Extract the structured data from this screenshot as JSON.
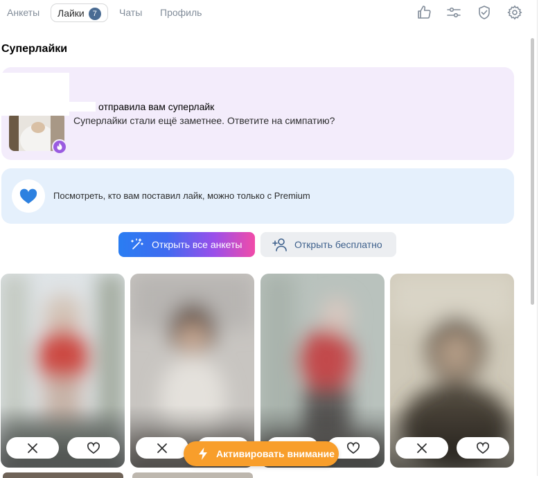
{
  "nav": {
    "tabs": [
      {
        "label": "Анкеты",
        "active": false
      },
      {
        "label": "Лайки",
        "active": true,
        "badge": "7"
      },
      {
        "label": "Чаты",
        "active": false
      },
      {
        "label": "Профиль",
        "active": false
      }
    ],
    "icons": [
      "thumbs-up-icon",
      "filter-sliders-icon",
      "shield-check-icon",
      "settings-gear-icon"
    ]
  },
  "superlikes": {
    "section_title": "Суперлайки",
    "card_title": "отправила вам суперлайк",
    "card_text": "Суперлайки стали ещё заметнее. Ответите на симпатию?",
    "badge_icon": "flame-icon",
    "background": "#f3ecfb"
  },
  "premium": {
    "text": "Посмотреть, кто вам поставил лайк, можно только с Premium",
    "icon": "heart-icon",
    "background": "#e5f0fc",
    "accent": "#2d81e0"
  },
  "actions": {
    "open_all": "Открыть все анкеты",
    "open_free": "Открыть бесплатно"
  },
  "profiles": [
    {
      "blur_colors": [
        "#dfe4e7",
        "#cc4a43",
        "#9aa39b"
      ]
    },
    {
      "blur_colors": [
        "#c9c6c2",
        "#6e5a4e",
        "#d8d4cf"
      ]
    },
    {
      "blur_colors": [
        "#b9c2bd",
        "#c24a4c",
        "#6f6d69"
      ]
    },
    {
      "blur_colors": [
        "#cfc9b9",
        "#5d5346",
        "#8a8378"
      ]
    }
  ],
  "boost": {
    "label": "Активировать внимание",
    "color": "#f89e2b"
  }
}
